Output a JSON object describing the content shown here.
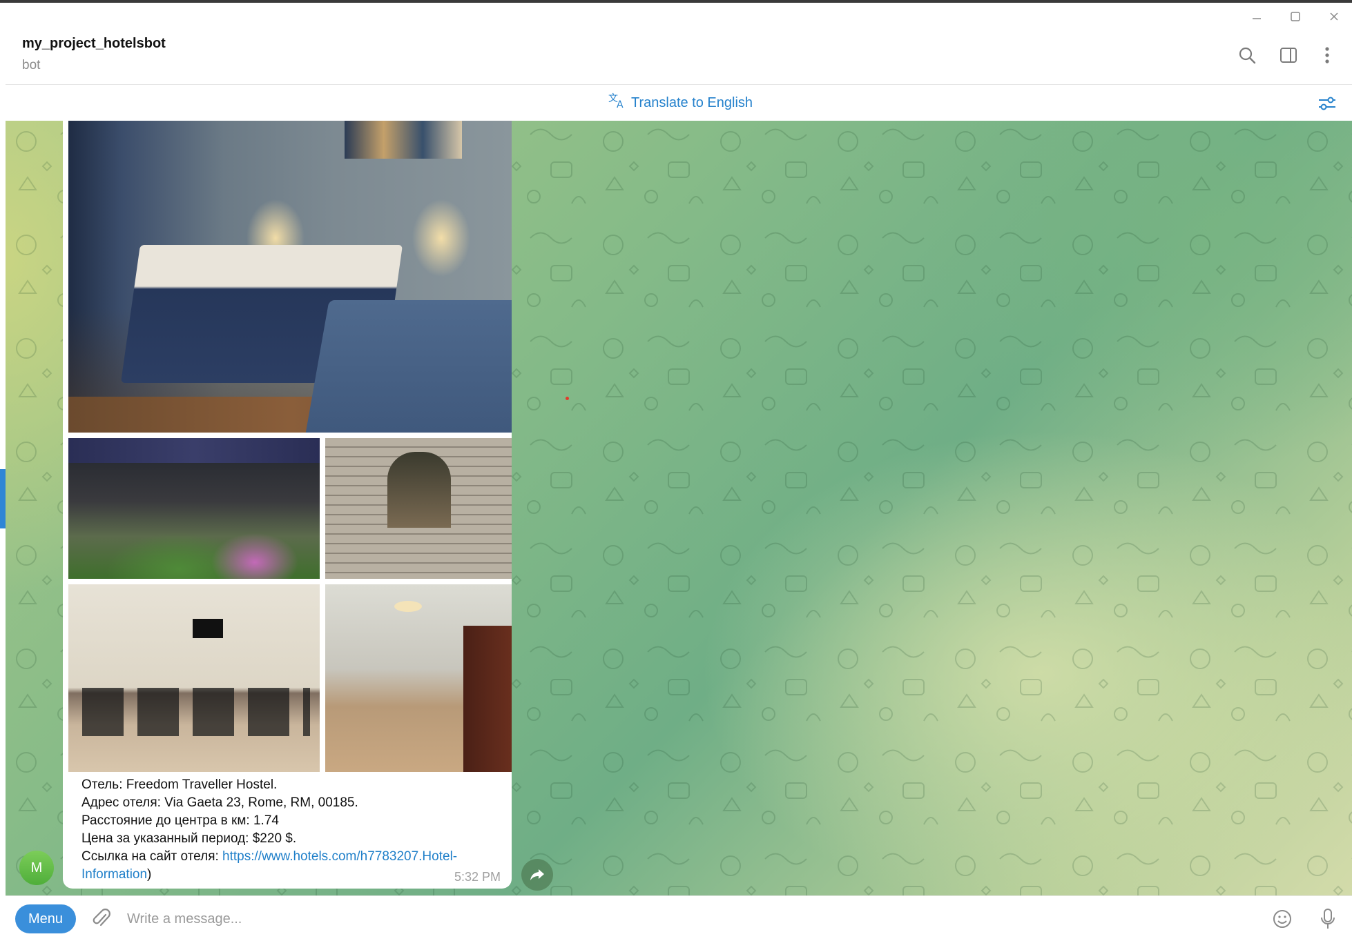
{
  "chat": {
    "title": "my_project_hotelsbot",
    "subtitle": "bot"
  },
  "translate": {
    "label": "Translate to English"
  },
  "message": {
    "lines": [
      "Отель: Freedom Traveller Hostel.",
      "Адрес отеля: Via Gaeta 23, Rome, RM, 00185.",
      "Расстояние до центра в км: 1.74",
      "Цена за указанный период: $220 $."
    ],
    "link_prefix": "Ссылка на сайт отеля: ",
    "link_text": "https://www.hotels.com/h7783207.Hotel-Information",
    "link_suffix": ")",
    "time": "5:32 PM",
    "photo_count": 5
  },
  "sender": {
    "avatar_letter": "M"
  },
  "composer": {
    "menu_label": "Menu",
    "placeholder": "Write a message..."
  },
  "icons": {
    "window": [
      "minimize-icon",
      "maximize-icon",
      "close-icon"
    ],
    "header": [
      "search-icon",
      "sidebar-toggle-icon",
      "more-vertical-icon"
    ],
    "translate": [
      "translate-icon",
      "translate-settings-icon"
    ],
    "composer": [
      "attach-icon",
      "emoji-icon",
      "microphone-icon"
    ],
    "message": [
      "share-icon"
    ]
  },
  "colors": {
    "accent": "#2481cc",
    "menu_button": "#3a8fdb",
    "avatar": "#5fbc45",
    "link": "#1f7fc9"
  }
}
